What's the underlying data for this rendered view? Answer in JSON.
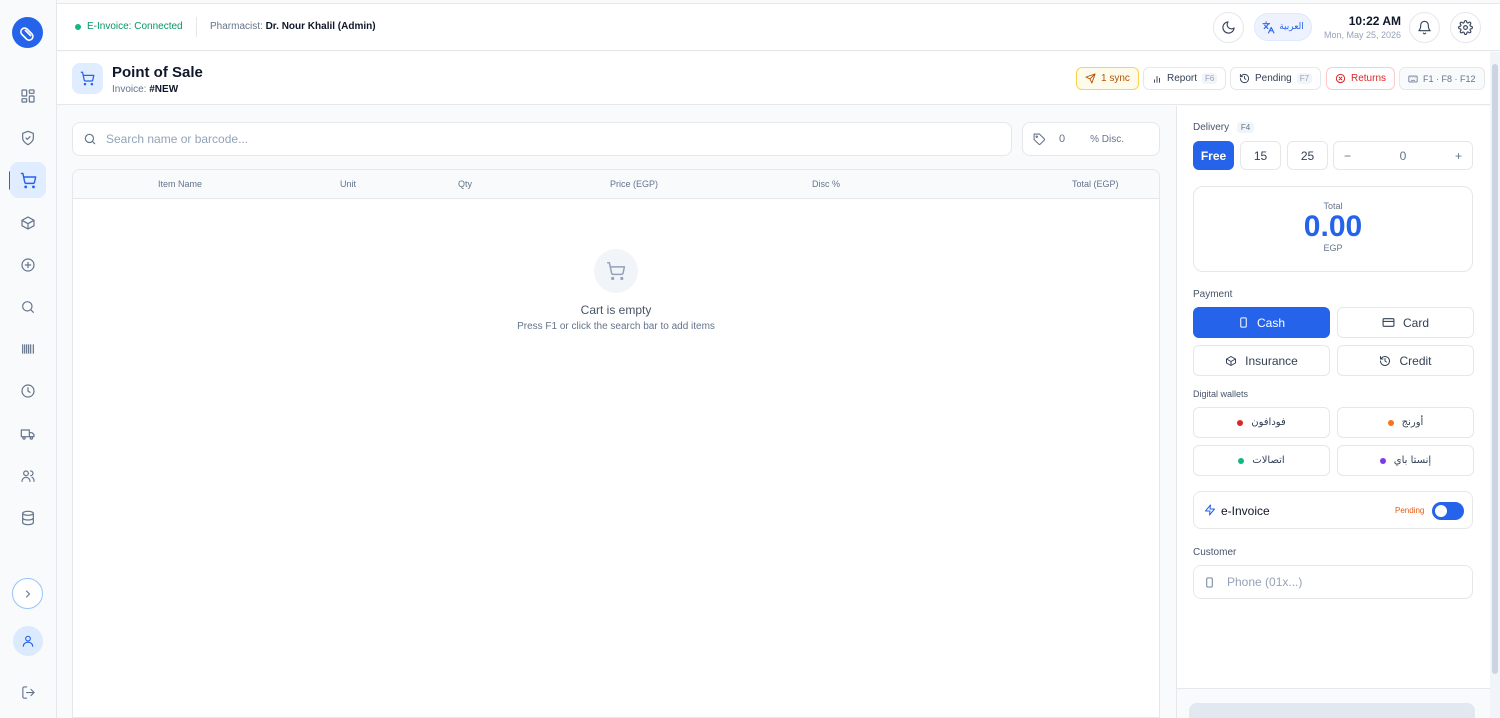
{
  "topbar": {
    "einvoice_status": "E-Invoice: Connected",
    "pharmacist_label": "Pharmacist:",
    "pharmacist_name": "Dr. Nour Khalil (Admin)",
    "language_label": "العربية",
    "time": "10:22 AM",
    "date": "Mon, May 25, 2026"
  },
  "page": {
    "title": "Point of Sale",
    "invoice_label": "Invoice:",
    "invoice_number": "#NEW"
  },
  "actions": {
    "sync_label": "1 sync",
    "report_label": "Report",
    "report_key": "F6",
    "pending_label": "Pending",
    "pending_key": "F7",
    "returns_label": "Returns",
    "shortcuts_label": "F1 · F8 · F12"
  },
  "search": {
    "placeholder": "Search name or barcode...",
    "value": ""
  },
  "discount": {
    "value": "0",
    "label": "% Disc."
  },
  "cart": {
    "columns": [
      "Item Name",
      "Unit",
      "Qty",
      "Price (EGP)",
      "Disc %",
      "Total (EGP)"
    ],
    "rows": [],
    "empty_title": "Cart is empty",
    "empty_hint": "Press F1 or click the search bar to add items"
  },
  "delivery": {
    "label": "Delivery",
    "key": "F4",
    "options": [
      "Free",
      "15",
      "25"
    ],
    "selected": "Free",
    "custom_value": "0",
    "minus": "−",
    "plus": "+"
  },
  "total": {
    "label": "Total",
    "value": "0.00",
    "currency": "EGP"
  },
  "payment": {
    "label": "Payment",
    "methods": [
      "Cash",
      "Card",
      "Insurance",
      "Credit"
    ],
    "selected": "Cash"
  },
  "wallets": {
    "label": "Digital wallets",
    "items": [
      {
        "name": "فودافون",
        "color": "#dc2626"
      },
      {
        "name": "أورنج",
        "color": "#f97316"
      },
      {
        "name": "اتصالات",
        "color": "#10b981"
      },
      {
        "name": "إنستا باي",
        "color": "#7c3aed"
      }
    ]
  },
  "einvoice": {
    "label": "e-Invoice",
    "status": "Pending",
    "enabled": true
  },
  "customer": {
    "label": "Customer",
    "phone_placeholder": "Phone (01x...)",
    "phone_value": ""
  },
  "colors": {
    "accent": "#2563eb",
    "success": "#10b981",
    "danger": "#dc2626",
    "warning": "#b45309"
  }
}
